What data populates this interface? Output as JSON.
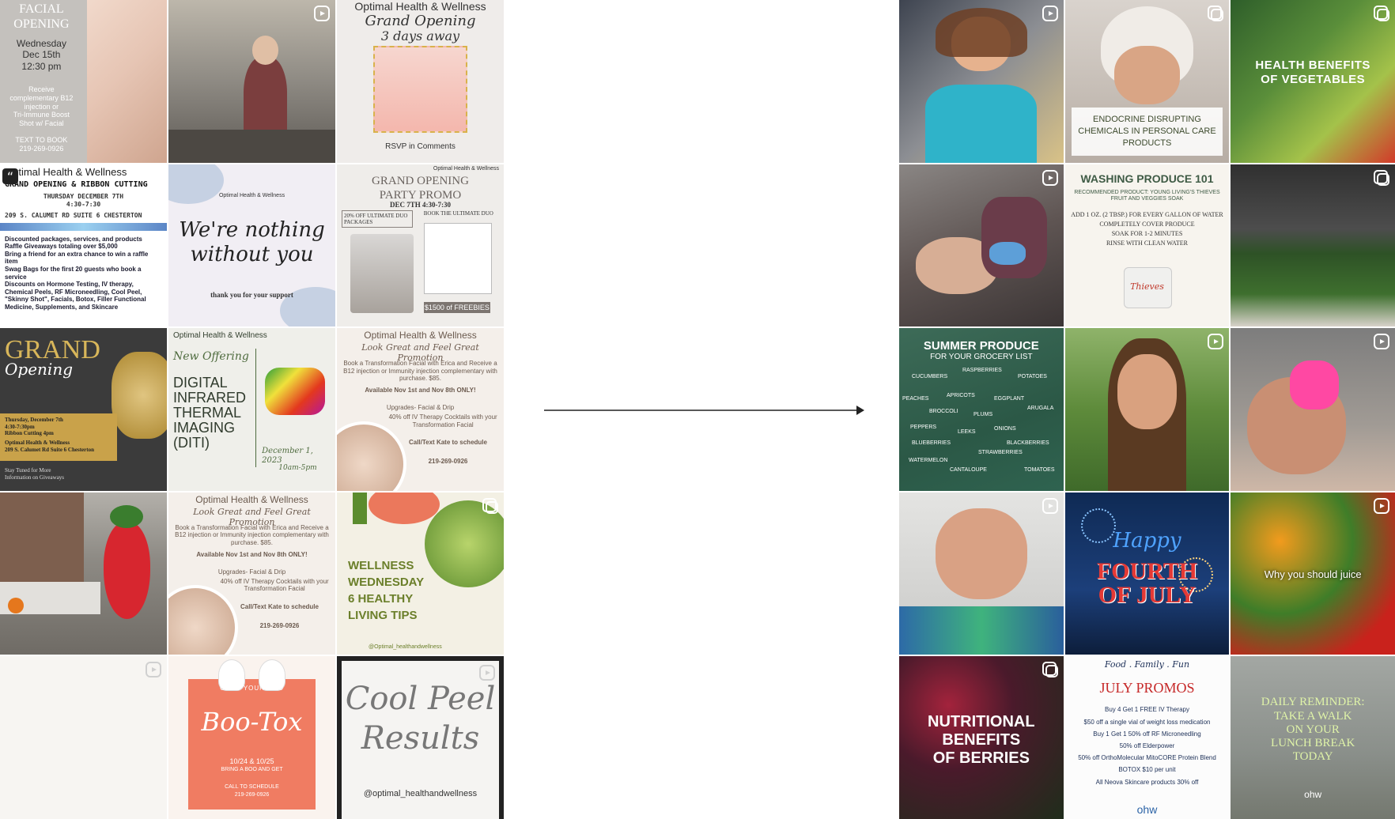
{
  "left_posts": [
    {
      "id": "facial-opening",
      "lines": [
        "FACIAL",
        "OPENING",
        "Wednesday",
        "Dec 15th",
        "12:30 pm",
        "Receive",
        "complementary B12",
        "injection or",
        "Tri-Immune Boost",
        "Shot w/ Facial",
        "TEXT TO BOOK",
        "219-269-0926"
      ]
    },
    {
      "id": "shop-photo",
      "lines": []
    },
    {
      "id": "grand-opening-3days",
      "lines": [
        "Optimal Health & Wellness",
        "Grand Opening",
        "3 days away",
        "RSVP in Comments"
      ]
    },
    {
      "id": "ribbon-cutting",
      "lines": [
        "Optimal Health & Wellness",
        "GRAND OPENING & RIBBON CUTTING",
        "THURSDAY DECEMBER 7TH",
        "4:30-7:30",
        "209 S. CALUMET RD SUITE 6 CHESTERTON",
        "Discounted packages, services, and products",
        "Raffle Giveaways totaling over $5,000",
        "Bring a friend for an extra chance to win a raffle item",
        "Swag Bags for the first 20 guests who book a service",
        "Discounts on Hormone Testing, IV therapy, Chemical Peels, RF Microneedling, Cool Peel, \"Skinny Shot\", Facials, Botox, Filler Functional Medicine, Supplements, and Skincare"
      ]
    },
    {
      "id": "nothing-without-you",
      "lines": [
        "Optimal Health & Wellness",
        "We're nothing without you",
        "thank you for your support"
      ]
    },
    {
      "id": "party-promo",
      "lines": [
        "Optimal Health & Wellness",
        "GRAND OPENING",
        "PARTY PROMO",
        "DEC 7TH 4:30-7:30",
        "20% OFF ULTIMATE DUO PACKAGES",
        "BOOK THE ULTIMATE DUO",
        "$1500 of FREEBIES"
      ]
    },
    {
      "id": "grand-opening-gold",
      "lines": [
        "GRAND",
        "Opening",
        "Thursday, December 7th",
        "4:30-7:30pm",
        "Ribbon Cutting 4pm",
        "Optimal Health & Wellness",
        "209 S. Calumet Rd Suite 6 Chesterton",
        "Stay Tuned for More",
        "Information on Giveaways"
      ]
    },
    {
      "id": "thermal-imaging",
      "lines": [
        "Optimal Health & Wellness",
        "New Offering",
        "DIGITAL",
        "INFRARED",
        "THERMAL",
        "IMAGING",
        "(DITI)",
        "December 1, 2023",
        "10am-5pm"
      ]
    },
    {
      "id": "promo-1",
      "lines": [
        "Optimal Health & Wellness",
        "Look Great and Feel Great Promotion",
        "Book a Transformation Facial with Erica and Receive a B12 injection or Immunity injection complementary with purchase. $85.",
        "Available Nov 1st and Nov 8th ONLY!",
        "Upgrades- Facial & Drip",
        "40% off IV Therapy Cocktails with your Transformation Facial",
        "Call/Text Kate to schedule",
        "219-269-0926"
      ]
    },
    {
      "id": "strawberry-costume",
      "lines": []
    },
    {
      "id": "promo-2",
      "lines": [
        "Optimal Health & Wellness",
        "Look Great and Feel Great Promotion",
        "Book a Transformation Facial with Erica and Receive a B12 injection or Immunity injection complementary with purchase. $85.",
        "Available Nov 1st and Nov 8th ONLY!",
        "Upgrades- Facial & Drip",
        "40% off IV Therapy Cocktails with your Transformation Facial",
        "Call/Text Kate to schedule",
        "219-269-0926"
      ]
    },
    {
      "id": "wellness-wednesday",
      "lines": [
        "WELLNESS",
        "WEDNESDAY",
        "6 HEALTHY",
        "LIVING TIPS",
        "@Optimal_healthandwellness"
      ]
    },
    {
      "id": "blank-reel",
      "lines": []
    },
    {
      "id": "boo-tox",
      "lines": [
        "GRAB YOUR BOO",
        "Boo-Tox",
        "10/24 & 10/25",
        "BRING A BOO AND GET",
        "CALL TO SCHEDULE",
        "219-269-0926"
      ]
    },
    {
      "id": "cool-peel",
      "lines": [
        "Cool Peel",
        "Results",
        "@optimal_healthandwellness"
      ]
    }
  ],
  "right_posts": [
    {
      "id": "woman-teal",
      "lines": []
    },
    {
      "id": "endocrine",
      "lines": [
        "ENDOCRINE DISRUPTING",
        "CHEMICALS IN PERSONAL CARE",
        "PRODUCTS"
      ]
    },
    {
      "id": "veg-benefits",
      "lines": [
        "HEALTH BENEFITS",
        "OF VEGETABLES"
      ]
    },
    {
      "id": "facial-treatment",
      "lines": []
    },
    {
      "id": "washing-produce",
      "lines": [
        "WASHING PRODUCE 101",
        "RECOMMENDED PRODUCT: YOUNG LIVING'S THIEVES FRUIT AND VEGGIES SOAK",
        "ADD 1 OZ. (2 TBSP.) FOR EVERY GALLON OF WATER",
        "COMPLETELY COVER PRODUCE",
        "SOAK FOR 1-2 MINUTES",
        "RINSE WITH CLEAN WATER",
        "Thieves"
      ]
    },
    {
      "id": "cucumbers",
      "lines": []
    },
    {
      "id": "summer-produce",
      "lines": [
        "SUMMER PRODUCE",
        "FOR YOUR GROCERY LIST",
        "CUCUMBERS",
        "RASPBERRIES",
        "POTATOES",
        "PEACHES",
        "APRICOTS",
        "EGGPLANT",
        "BROCCOLI",
        "PLUMS",
        "ARUGALA",
        "PEPPERS",
        "LEEKS",
        "ONIONS",
        "BLUEBERRIES",
        "BLACKBERRIES",
        "STRAWBERRIES",
        "WATERMELON",
        "CANTALOUPE",
        "TOMATOES"
      ]
    },
    {
      "id": "woman-outdoor",
      "lines": []
    },
    {
      "id": "brow-treatment",
      "lines": []
    },
    {
      "id": "woman-selfie",
      "lines": []
    },
    {
      "id": "fourth-july",
      "lines": [
        "Happy",
        "FOURTH",
        "OF JULY"
      ]
    },
    {
      "id": "juice",
      "lines": [
        "Why you should juice"
      ]
    },
    {
      "id": "berries",
      "lines": [
        "NUTRITIONAL",
        "BENEFITS",
        "OF BERRIES"
      ]
    },
    {
      "id": "july-promos",
      "lines": [
        "Food . Family . Fun",
        "JULY PROMOS",
        "Buy 4 Get 1 FREE IV Therapy",
        "$50 off a single vial of weight loss medication",
        "Buy 1 Get 1 50% off RF Microneedling",
        "50% off Elderpower",
        "50% off OrthoMolecular MitoCORE Protein Blend",
        "BOTOX $10 per unit",
        "All Neova Skincare products 30% off",
        "ohw"
      ]
    },
    {
      "id": "walk-reminder",
      "lines": [
        "DAILY REMINDER:",
        "TAKE A WALK",
        "ON YOUR",
        "LUNCH BREAK",
        "TODAY",
        "ohw"
      ]
    }
  ],
  "colors": {
    "arrow": "#222222",
    "gold": "#c9a24a",
    "coral": "#f07c62",
    "navy": "#1c2f57"
  },
  "icons": {
    "reel": "reel-icon",
    "carousel": "carousel-icon",
    "quote": "quote-icon"
  }
}
